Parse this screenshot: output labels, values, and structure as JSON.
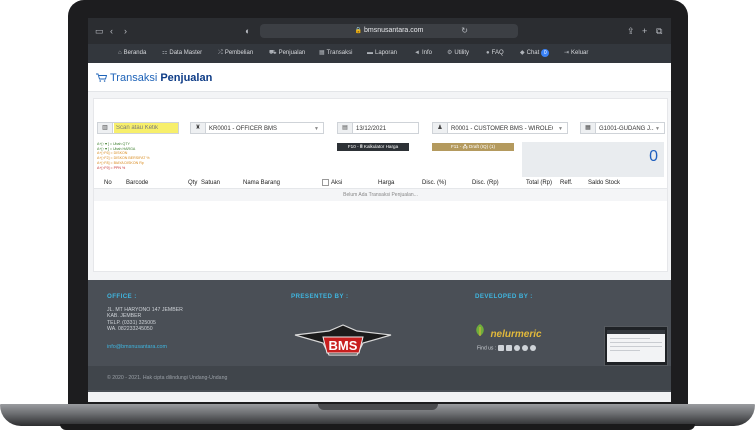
{
  "browser": {
    "url": "bmsnusantara.com"
  },
  "nav": {
    "items": [
      {
        "label": "Beranda",
        "icon": "home-icon"
      },
      {
        "label": "Data Master",
        "icon": "sitemap-icon"
      },
      {
        "label": "Pembelian",
        "icon": "shuffle-icon"
      },
      {
        "label": "Penjualan",
        "icon": "cart-icon"
      },
      {
        "label": "Transaksi",
        "icon": "calculator-icon"
      },
      {
        "label": "Laporan",
        "icon": "folder-icon"
      },
      {
        "label": "Info",
        "icon": "bullhorn-icon"
      },
      {
        "label": "Utility",
        "icon": "cogs-icon"
      },
      {
        "label": "FAQ",
        "icon": "question-icon"
      },
      {
        "label": "Chat",
        "icon": "chat-icon",
        "badge": "0"
      },
      {
        "label": "Keluar",
        "icon": "logout-icon"
      }
    ]
  },
  "page": {
    "title_light": "Transaksi",
    "title_bold": "Penjualan"
  },
  "form": {
    "search_placeholder": "Scan atau Ketik",
    "officer": "KR0001 - OFFICER BMS",
    "date": "13/12/2021",
    "customer": "R0001 - CUSTOMER BMS - WIROLEGI",
    "warehouse": "G1001-GUDANG J...",
    "hints": [
      {
        "text": "A+[↑▼] = Ubah QTY",
        "color": "#3a7d2a"
      },
      {
        "text": "A+[↑▼] = Ubah HARGA",
        "color": "#3a7d2a"
      },
      {
        "text": "A+[↑F6] = DISKON",
        "color": "#d8891b"
      },
      {
        "text": "A+[↑F2] = DISKON BERSIFAT %",
        "color": "#d8891b"
      },
      {
        "text": "A+[↑F8] = BIAYA DISKON Rp",
        "color": "#d8891b"
      },
      {
        "text": "A+[↑F9] = PPN %",
        "color": "#c53030"
      }
    ],
    "kalkulator_label": "F10 - 🖩 Kalkulator Harga",
    "draft_label": "F11 - 🖧 Draft (IQ) (1)",
    "total": "0"
  },
  "table": {
    "columns": [
      "No",
      "Barcode",
      "Qty",
      "Satuan",
      "Nama Barang",
      "Aksi",
      "Harga",
      "Disc. (%)",
      "Disc. (Rp)",
      "Total (Rp)",
      "Reff.",
      "Saldo Stock"
    ],
    "empty_message": "Belum Ada Transaksi Penjualan..."
  },
  "footer": {
    "office_heading": "OFFICE :",
    "office_lines": [
      "JL. MT HARYONO 147 JEMBER",
      "KAB. JEMBER",
      "TELP. (0331) 325005",
      "WA. 082233245050"
    ],
    "email": "info@bmsnusantara.com",
    "presented_heading": "PRESENTED BY :",
    "presented_logo": "BMS",
    "developed_heading": "DEVELOPED BY :",
    "developer_name": "nelurmeric",
    "find_us": "Find us :",
    "copyright": "© 2020 - 2021. Hak cipta dilindungi Undang-Undang"
  },
  "colors": {
    "accent": "#1f5fbf",
    "search_highlight": "#f7ef6b",
    "footer_bg": "#4a4f56",
    "footer_heading": "#3fb6e0"
  }
}
